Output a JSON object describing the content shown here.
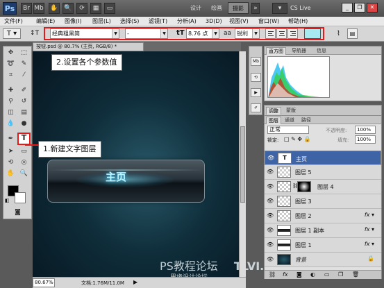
{
  "app": {
    "logo": "Ps",
    "workspaces": [
      "设计",
      "绘画",
      "摄影"
    ],
    "active_workspace": "摄影",
    "cslive": "CS Live"
  },
  "menu": [
    "文件(F)",
    "编辑(E)",
    "图像(I)",
    "图层(L)",
    "选择(S)",
    "滤镜(T)",
    "分析(A)",
    "3D(D)",
    "视图(V)",
    "窗口(W)",
    "帮助(H)"
  ],
  "options": {
    "font_family": "经典粗黑简",
    "font_style": "-",
    "font_size": "8.76 点",
    "aa_label": "aa",
    "antialias": "锐利",
    "text_color": "#a7eaf0"
  },
  "document": {
    "tab_title": "按钮.psd @ 80.7% (主页, RGB/8) *",
    "zoom": "80.67%",
    "doc_info": "文档:1.76M/11.0M",
    "button_label": "主页",
    "watermark": "PS教程论坛",
    "watermark_sub": "思缘设计论坛",
    "watermark_right": "TLVI.NET"
  },
  "callouts": {
    "new_text_layer": "1.新建文字图层",
    "set_params": "2.设置各个参数值"
  },
  "panels": {
    "histogram_tabs": [
      "直方图",
      "导航器",
      "信息"
    ],
    "adjust_tabs": [
      "调整",
      "蒙版"
    ],
    "layers_tabs": [
      "图层",
      "通道",
      "路径"
    ],
    "blend_mode": "正常",
    "opacity_label": "不透明度:",
    "opacity": "100%",
    "lock_label": "锁定:",
    "fill_label": "填充:",
    "fill": "100%"
  },
  "layers": [
    {
      "name": "主页",
      "selected": true,
      "type": "text",
      "fx": false
    },
    {
      "name": "图层 5",
      "selected": false,
      "type": "normal",
      "fx": false
    },
    {
      "name": "图层 4",
      "selected": false,
      "type": "masked",
      "fx": false
    },
    {
      "name": "图层 3",
      "selected": false,
      "type": "normal",
      "fx": false
    },
    {
      "name": "图层 2",
      "selected": false,
      "type": "normal",
      "fx": true
    },
    {
      "name": "图层 1 副本",
      "selected": false,
      "type": "bar",
      "fx": true
    },
    {
      "name": "图层 1",
      "selected": false,
      "type": "bar",
      "fx": true
    },
    {
      "name": "背景",
      "selected": false,
      "type": "background",
      "fx": false
    }
  ]
}
